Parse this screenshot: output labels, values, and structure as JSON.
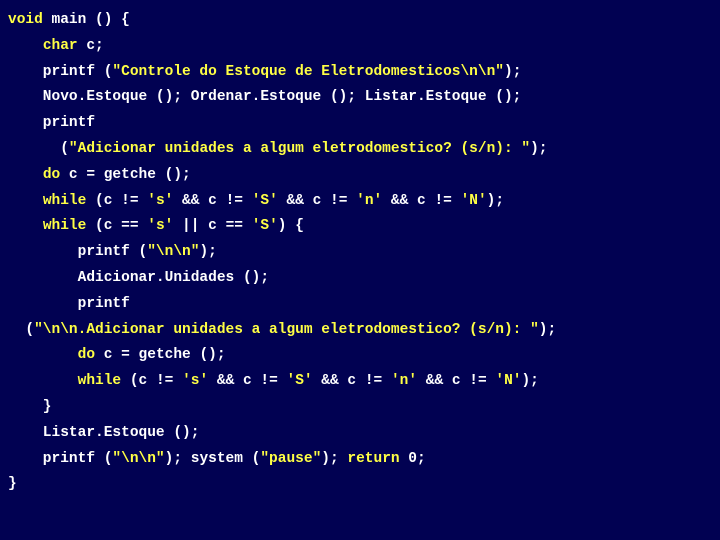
{
  "code": {
    "l01a": "void",
    "l01b": " main () {",
    "l02a": "    ",
    "l02b": "char",
    "l02c": " c;",
    "l03a": "    printf (",
    "l03b": "\"Controle do Estoque de Eletrodomesticos\\n\\n\"",
    "l03c": ");",
    "l04": "    Novo.Estoque (); Ordenar.Estoque (); Listar.Estoque ();",
    "l05": "    printf",
    "l06a": "      (",
    "l06b": "\"Adicionar unidades a algum eletrodomestico? (s/n): \"",
    "l06c": ");",
    "l07a": "    ",
    "l07b": "do",
    "l07c": " c = getche ();",
    "l08a": "    ",
    "l08b": "while",
    "l08c": " (c != ",
    "l08d": "'s'",
    "l08e": " && c != ",
    "l08f": "'S'",
    "l08g": " && c != ",
    "l08h": "'n'",
    "l08i": " && c != ",
    "l08j": "'N'",
    "l08k": ");",
    "l09a": "    ",
    "l09b": "while",
    "l09c": " (c == ",
    "l09d": "'s'",
    "l09e": " || c == ",
    "l09f": "'S'",
    "l09g": ") {",
    "l10a": "        printf (",
    "l10b": "\"\\n\\n\"",
    "l10c": ");",
    "l11": "        Adicionar.Unidades ();",
    "l12": "        printf",
    "l13a": "  (",
    "l13b": "\"\\n\\n.Adicionar unidades a algum eletrodomestico? (s/n): \"",
    "l13c": ");",
    "l14a": "        ",
    "l14b": "do",
    "l14c": " c = getche ();",
    "l15a": "        ",
    "l15b": "while",
    "l15c": " (c != ",
    "l15d": "'s'",
    "l15e": " && c != ",
    "l15f": "'S'",
    "l15g": " && c != ",
    "l15h": "'n'",
    "l15i": " && c != ",
    "l15j": "'N'",
    "l15k": ");",
    "l16": "    }",
    "l17": "    Listar.Estoque ();",
    "l18a": "    printf (",
    "l18b": "\"\\n\\n\"",
    "l18c": "); system (",
    "l18d": "\"pause\"",
    "l18e": "); ",
    "l18f": "return",
    "l18g": " 0;",
    "l19": "}"
  }
}
